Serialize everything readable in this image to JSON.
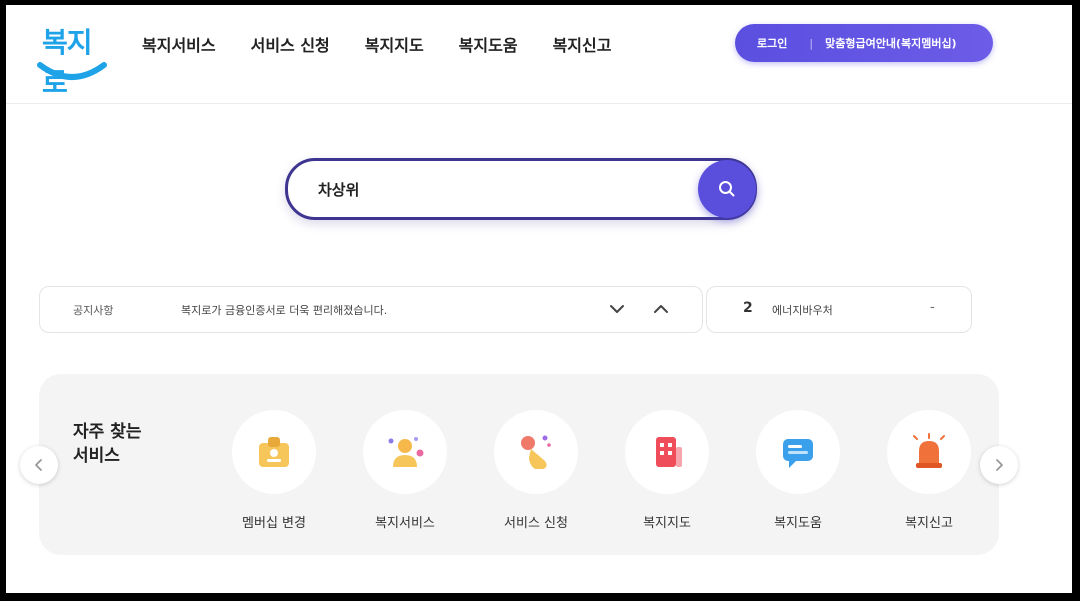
{
  "header": {
    "logo_text": "복지로",
    "nav": [
      "복지서비스",
      "서비스 신청",
      "복지지도",
      "복지도움",
      "복지신고"
    ],
    "login_label": "로그인",
    "separator": "|",
    "guide_label": "맞춤형급여안내(복지멤버십)"
  },
  "search": {
    "value": "차상위"
  },
  "notice": {
    "label": "공지사항",
    "text": "복지로가 금융인증서로 더욱 편리해졌습니다."
  },
  "ranking": {
    "rank": "2",
    "text": "에너지바우처",
    "change": "-"
  },
  "services": {
    "title_line1": "자주 찾는",
    "title_line2": "서비스",
    "items": [
      {
        "label": "멤버십 변경",
        "icon": "membership-icon"
      },
      {
        "label": "복지서비스",
        "icon": "person-icon"
      },
      {
        "label": "서비스 신청",
        "icon": "hand-touch-icon"
      },
      {
        "label": "복지지도",
        "icon": "building-icon"
      },
      {
        "label": "복지도움",
        "icon": "chat-bubble-icon"
      },
      {
        "label": "복지신고",
        "icon": "siren-icon"
      }
    ]
  },
  "colors": {
    "accent": "#5a4fdc",
    "logo": "#1fa3e8"
  }
}
